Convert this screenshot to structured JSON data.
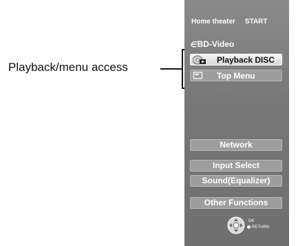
{
  "callout": {
    "label": "Playback/menu access"
  },
  "panel": {
    "header_title": "Home theater",
    "header_action": "START",
    "source_icon": "disc-icon",
    "source_label": "BD-Video",
    "source_buttons": [
      {
        "label": "Playback DISC",
        "icon": "disc-play-icon",
        "state": "selected"
      },
      {
        "label": "Top Menu",
        "icon": "menu-screen-icon",
        "state": "normal"
      }
    ],
    "function_buttons": [
      {
        "label": "Network"
      },
      {
        "label": "Input Select"
      },
      {
        "label": "Sound(Equalizer)"
      },
      {
        "label": "Other Functions"
      }
    ],
    "key_guide": {
      "ok_label": "OK",
      "return_label": "RETURN",
      "icons": [
        "dpad-icon",
        "return-dot-icon"
      ]
    }
  },
  "colors": {
    "panel_bg": "#7b7b7b",
    "selected_button_bg": "#e8e8e8",
    "button_bg": "#9d9d9d",
    "text_light": "#ffffff",
    "text_dark": "#111111"
  }
}
